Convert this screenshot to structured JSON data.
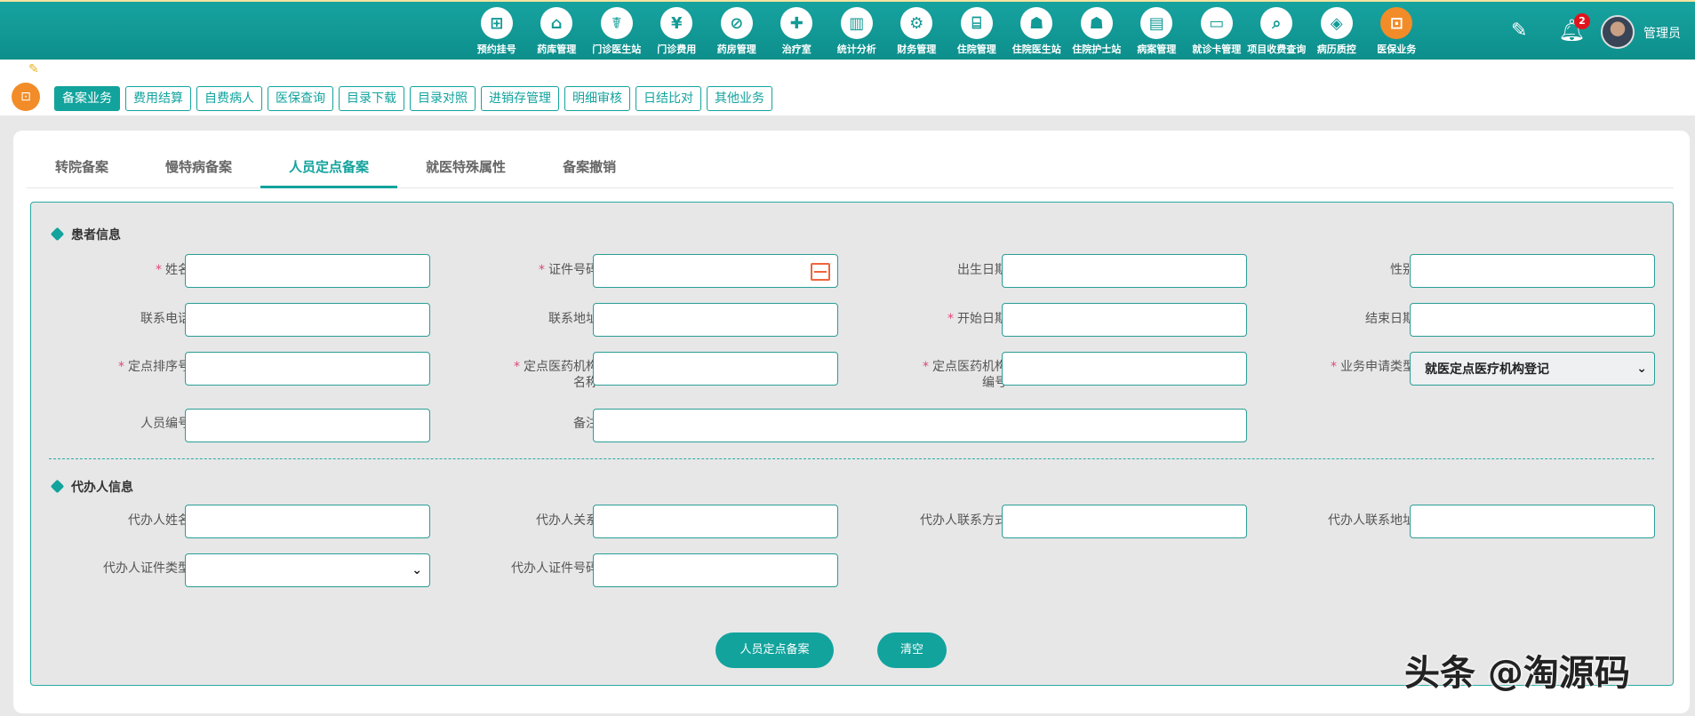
{
  "header": {
    "nav": [
      {
        "label": "预约挂号",
        "icon": "⊞",
        "name": "appointment"
      },
      {
        "label": "药库管理",
        "icon": "⌂",
        "name": "pharmacy-store"
      },
      {
        "label": "门诊医生站",
        "icon": "☤",
        "name": "outpatient-doctor"
      },
      {
        "label": "门诊费用",
        "icon": "¥",
        "name": "outpatient-fee"
      },
      {
        "label": "药房管理",
        "icon": "⊘",
        "name": "pharmacy"
      },
      {
        "label": "治疗室",
        "icon": "✚",
        "name": "treatment-room"
      },
      {
        "label": "统计分析",
        "icon": "▥",
        "name": "statistics"
      },
      {
        "label": "财务管理",
        "icon": "⚙",
        "name": "finance"
      },
      {
        "label": "住院管理",
        "icon": "⌸",
        "name": "inpatient"
      },
      {
        "label": "住院医生站",
        "icon": "☗",
        "name": "inpatient-doctor"
      },
      {
        "label": "住院护士站",
        "icon": "☗",
        "name": "inpatient-nurse"
      },
      {
        "label": "病案管理",
        "icon": "▤",
        "name": "medical-records"
      },
      {
        "label": "就诊卡管理",
        "icon": "▭",
        "name": "visit-card"
      },
      {
        "label": "项目收费查询",
        "icon": "⌕",
        "name": "fee-query"
      },
      {
        "label": "病历质控",
        "icon": "◈",
        "name": "record-qc"
      },
      {
        "label": "医保业务",
        "icon": "⊡",
        "name": "insurance",
        "active": true
      }
    ],
    "notification_count": "2",
    "username": "管理员"
  },
  "subnav": {
    "items": [
      "备案业务",
      "费用结算",
      "自费病人",
      "医保查询",
      "目录下载",
      "目录对照",
      "进销存管理",
      "明细审核",
      "日结比对",
      "其他业务"
    ]
  },
  "tabs": [
    "转院备案",
    "慢特病备案",
    "人员定点备案",
    "就医特殊属性",
    "备案撤销"
  ],
  "form": {
    "section1": "患者信息",
    "section2": "代办人信息",
    "fields": {
      "name": "姓名",
      "id_no": "证件号码",
      "birth": "出生日期",
      "gender": "性别",
      "phone": "联系电话",
      "address": "联系地址",
      "start": "开始日期",
      "end": "结束日期",
      "seq": "定点排序号",
      "org_name": "定点医药机构名称",
      "org_code": "定点医药机构编号",
      "biz_type": "业务申请类型",
      "person_no": "人员编号",
      "remark": "备注",
      "agent_name": "代办人姓名",
      "agent_rel": "代办人关系",
      "agent_contact": "代办人联系方式",
      "agent_addr": "代办人联系地址",
      "agent_cert_type": "代办人证件类型",
      "agent_cert_no": "代办人证件号码"
    },
    "biz_type_value": "就医定点医疗机构登记",
    "submit": "人员定点备案",
    "clear": "清空"
  },
  "watermark": "头条 @淘源码"
}
